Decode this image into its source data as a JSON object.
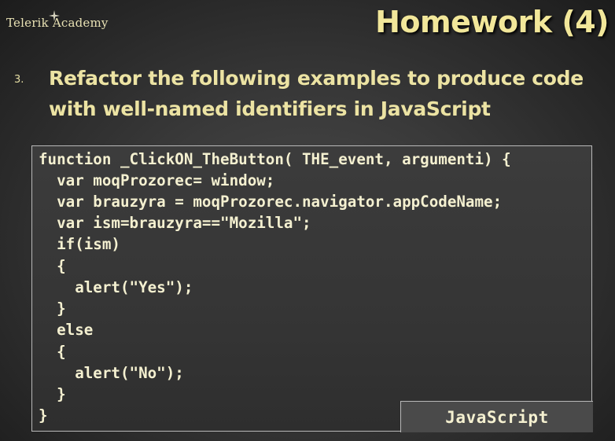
{
  "header": {
    "brand": "Telerik Academy",
    "title": "Homework (4)"
  },
  "task": {
    "number": "3.",
    "text": "Refactor the following examples to produce code with well-named identifiers in JavaScript"
  },
  "code": {
    "lines": [
      "function _ClickON_TheButton( THE_event, argumenti) {",
      "  var moqProzorec= window;",
      "  var brauzyra = moqProzorec.navigator.appCodeName;",
      "  var ism=brauzyra==\"Mozilla\";",
      "  if(ism)",
      "  {",
      "    alert(\"Yes\");",
      "  }",
      "  else",
      "  {",
      "    alert(\"No\");",
      "  }",
      "}"
    ],
    "language": "JavaScript"
  },
  "colors": {
    "title": "#f2e79a",
    "bullet_text": "#ece3a3",
    "code_text": "#f4f0d0",
    "code_border": "#b9b9b9"
  }
}
